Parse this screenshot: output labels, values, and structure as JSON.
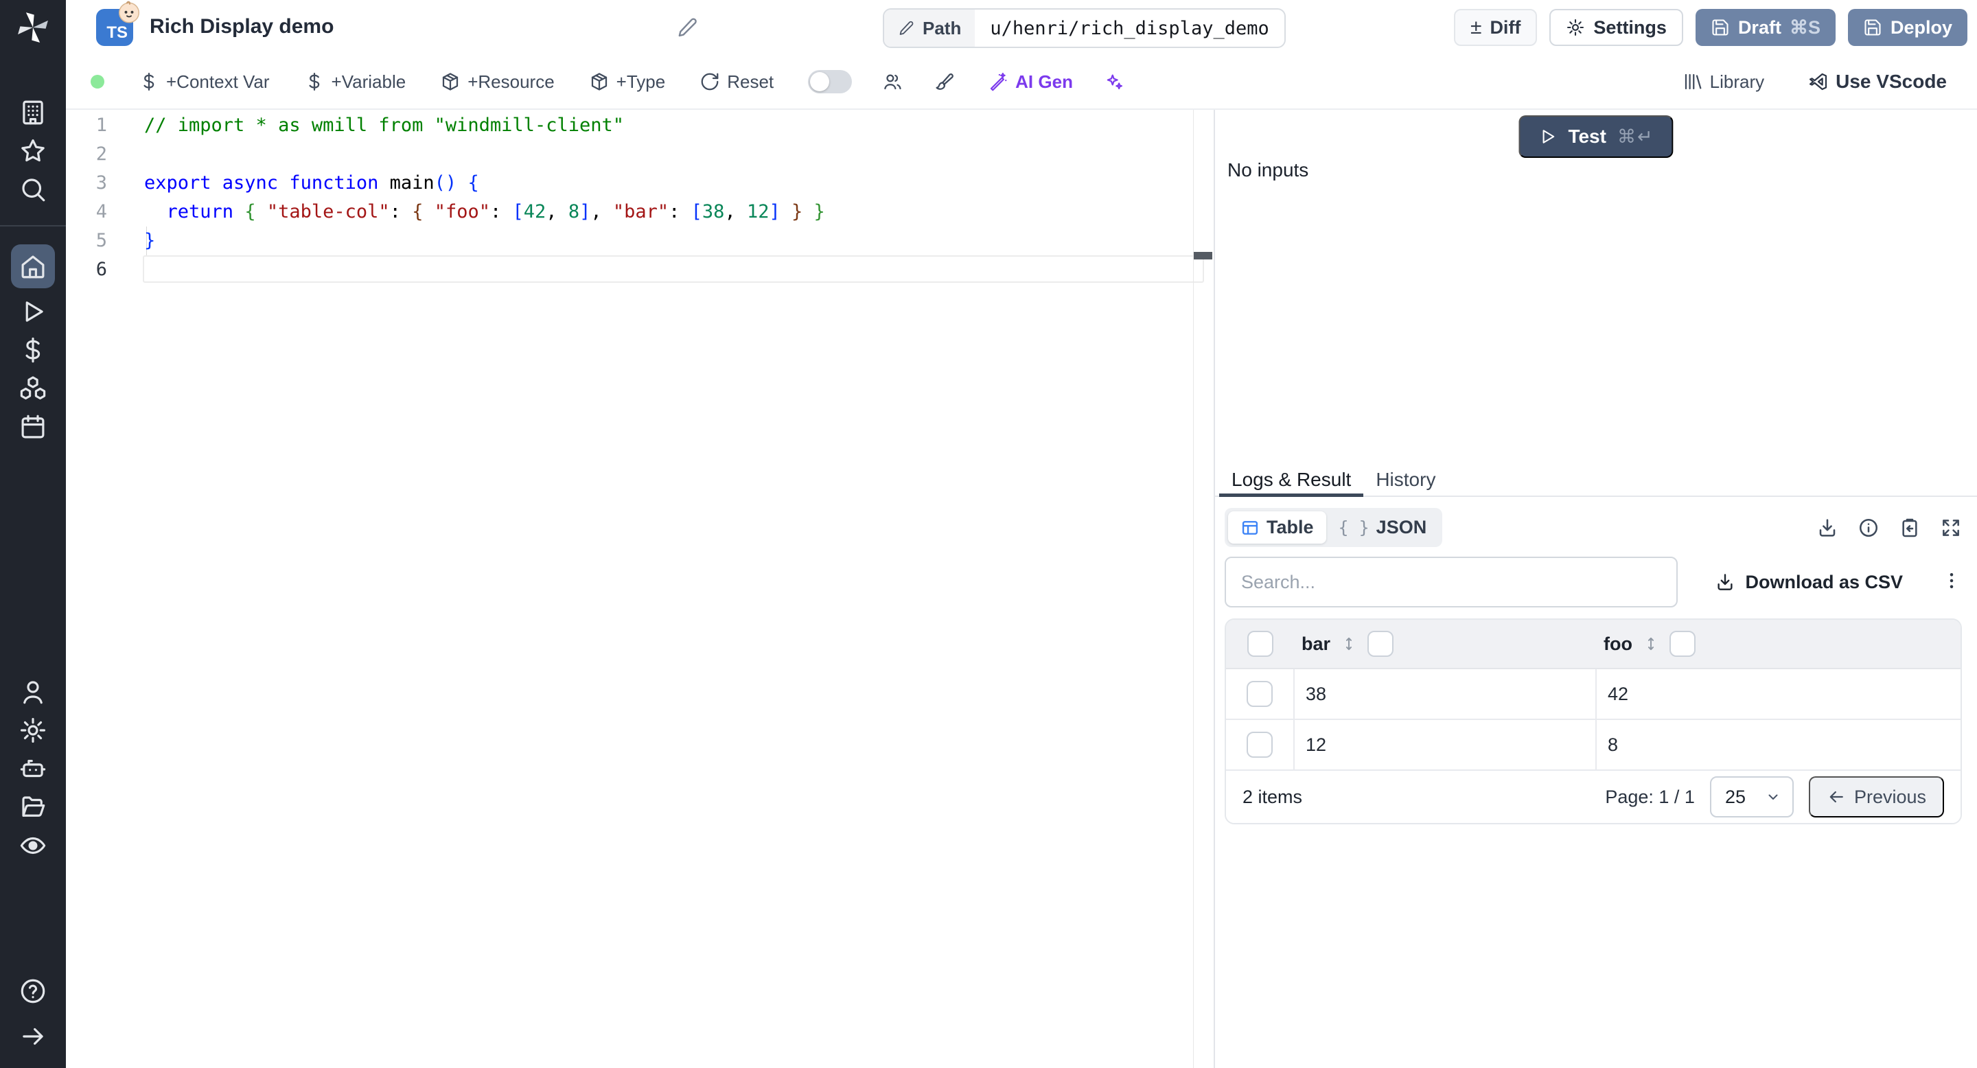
{
  "header": {
    "badge": "TS",
    "title": "Rich Display demo",
    "path_label": "Path",
    "path_value": "u/henri/rich_display_demo",
    "diff_icon": "±",
    "diff_label": "Diff",
    "settings_label": "Settings",
    "draft_label": "Draft",
    "draft_shortcut": "⌘S",
    "deploy_label": "Deploy",
    "badge_color": "#3b7ad1",
    "primary_button_color": "#6e84a6"
  },
  "toolbar": {
    "context_var": "+Context Var",
    "variable": "+Variable",
    "resource": "+Resource",
    "type": "+Type",
    "reset": "Reset",
    "ai_gen": "AI Gen",
    "library": "Library",
    "vscode": "Use VScode",
    "accent_purple": "#7c3aed",
    "status_dot_color": "#8ce99a"
  },
  "sidebar": {
    "top_icons": [
      "building",
      "star",
      "search"
    ],
    "main_icons": [
      "home",
      "play",
      "dollar",
      "boxes",
      "calendar"
    ],
    "active_icon": "home",
    "bottom_icons": [
      "user",
      "settings",
      "bot",
      "folder",
      "eye"
    ],
    "footer_icons": [
      "help",
      "arrow-right"
    ],
    "active_bg": "#4d5e77"
  },
  "editor": {
    "active_line": 6,
    "colors": {
      "comment": "#008000",
      "keyword": "#0000ff",
      "string": "#a31515",
      "number": "#098658",
      "plain": "#000000",
      "b1": "#0431fa",
      "b2": "#319331",
      "b3": "#7b3814"
    },
    "lines": [
      [
        {
          "t": "// import * as wmill from \"windmill-client\"",
          "c": "comment"
        }
      ],
      [],
      [
        {
          "t": "export async function ",
          "c": "keyword"
        },
        {
          "t": "main",
          "c": "plain"
        },
        {
          "t": "()",
          "c": "b1"
        },
        {
          "t": " ",
          "c": "plain"
        },
        {
          "t": "{",
          "c": "b1"
        }
      ],
      [
        {
          "t": "  ",
          "c": "plain"
        },
        {
          "t": "return",
          "c": "keyword"
        },
        {
          "t": " ",
          "c": "plain"
        },
        {
          "t": "{",
          "c": "b2"
        },
        {
          "t": " ",
          "c": "plain"
        },
        {
          "t": "\"table-col\"",
          "c": "string"
        },
        {
          "t": ": ",
          "c": "plain"
        },
        {
          "t": "{",
          "c": "b3"
        },
        {
          "t": " ",
          "c": "plain"
        },
        {
          "t": "\"foo\"",
          "c": "string"
        },
        {
          "t": ": ",
          "c": "plain"
        },
        {
          "t": "[",
          "c": "b1"
        },
        {
          "t": "42",
          "c": "number"
        },
        {
          "t": ", ",
          "c": "plain"
        },
        {
          "t": "8",
          "c": "number"
        },
        {
          "t": "]",
          "c": "b1"
        },
        {
          "t": ", ",
          "c": "plain"
        },
        {
          "t": "\"bar\"",
          "c": "string"
        },
        {
          "t": ": ",
          "c": "plain"
        },
        {
          "t": "[",
          "c": "b1"
        },
        {
          "t": "38",
          "c": "number"
        },
        {
          "t": ", ",
          "c": "plain"
        },
        {
          "t": "12",
          "c": "number"
        },
        {
          "t": "]",
          "c": "b1"
        },
        {
          "t": " ",
          "c": "plain"
        },
        {
          "t": "}",
          "c": "b3"
        },
        {
          "t": " ",
          "c": "plain"
        },
        {
          "t": "}",
          "c": "b2"
        }
      ],
      [
        {
          "t": "}",
          "c": "b1"
        }
      ],
      []
    ]
  },
  "panel": {
    "test_label": "Test",
    "test_shortcut": "⌘↵",
    "test_button_color": "#3e4e68",
    "no_inputs": "No inputs",
    "tabs": [
      {
        "label": "Logs & Result",
        "active": true
      },
      {
        "label": "History",
        "active": false
      }
    ],
    "view_toggle": {
      "table": "Table",
      "json": "JSON",
      "json_glyph": "{ }",
      "table_icon_color": "#3b82f6"
    },
    "search_placeholder": "Search...",
    "download_csv": "Download as CSV",
    "table": {
      "columns": [
        "bar",
        "foo"
      ],
      "rows": [
        [
          "38",
          "42"
        ],
        [
          "12",
          "8"
        ]
      ],
      "items_text": "2 items",
      "page_text": "Page: 1 / 1",
      "page_size": "25",
      "previous_label": "Previous"
    }
  }
}
